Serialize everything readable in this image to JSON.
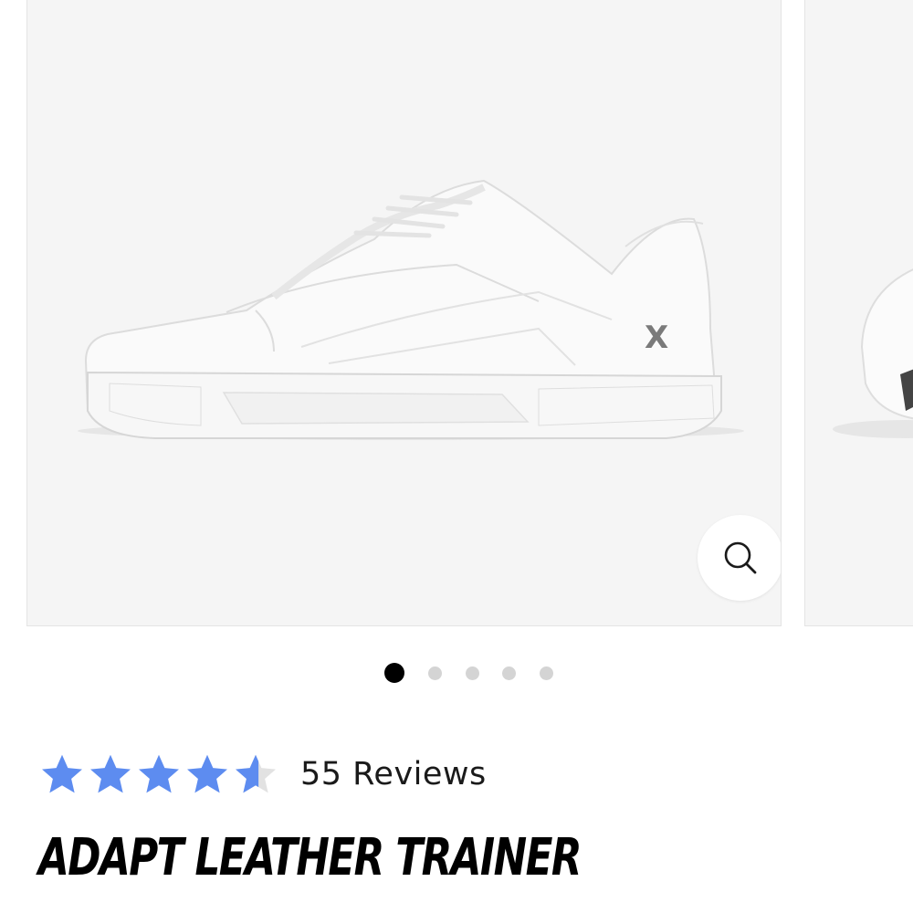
{
  "carousel": {
    "main_image_alt": "White leather low-top trainer, side view",
    "next_image_alt": "Next product image preview",
    "zoom_icon": "search-icon",
    "slide_count": 5,
    "active_slide": 1
  },
  "product": {
    "rating": 4.6,
    "rating_max": 5,
    "reviews_label": "55 Reviews",
    "title": "ADAPT LEATHER TRAINER"
  },
  "colors": {
    "star_filled": "#5d8cf0",
    "star_empty": "#e2e2e2",
    "dot_active": "#000000",
    "dot_inactive": "#d4d4d4",
    "image_bg": "#f5f5f5"
  }
}
